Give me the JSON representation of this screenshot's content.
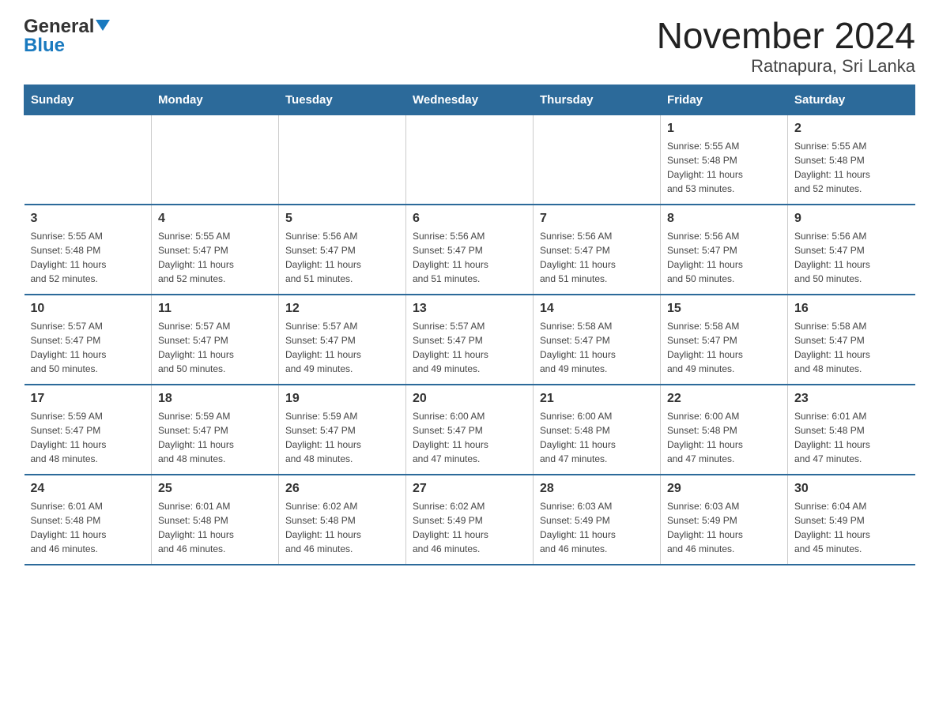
{
  "logo": {
    "general": "General",
    "blue": "Blue"
  },
  "title": "November 2024",
  "subtitle": "Ratnapura, Sri Lanka",
  "weekdays": [
    "Sunday",
    "Monday",
    "Tuesday",
    "Wednesday",
    "Thursday",
    "Friday",
    "Saturday"
  ],
  "weeks": [
    [
      {
        "day": "",
        "info": ""
      },
      {
        "day": "",
        "info": ""
      },
      {
        "day": "",
        "info": ""
      },
      {
        "day": "",
        "info": ""
      },
      {
        "day": "",
        "info": ""
      },
      {
        "day": "1",
        "info": "Sunrise: 5:55 AM\nSunset: 5:48 PM\nDaylight: 11 hours\nand 53 minutes."
      },
      {
        "day": "2",
        "info": "Sunrise: 5:55 AM\nSunset: 5:48 PM\nDaylight: 11 hours\nand 52 minutes."
      }
    ],
    [
      {
        "day": "3",
        "info": "Sunrise: 5:55 AM\nSunset: 5:48 PM\nDaylight: 11 hours\nand 52 minutes."
      },
      {
        "day": "4",
        "info": "Sunrise: 5:55 AM\nSunset: 5:47 PM\nDaylight: 11 hours\nand 52 minutes."
      },
      {
        "day": "5",
        "info": "Sunrise: 5:56 AM\nSunset: 5:47 PM\nDaylight: 11 hours\nand 51 minutes."
      },
      {
        "day": "6",
        "info": "Sunrise: 5:56 AM\nSunset: 5:47 PM\nDaylight: 11 hours\nand 51 minutes."
      },
      {
        "day": "7",
        "info": "Sunrise: 5:56 AM\nSunset: 5:47 PM\nDaylight: 11 hours\nand 51 minutes."
      },
      {
        "day": "8",
        "info": "Sunrise: 5:56 AM\nSunset: 5:47 PM\nDaylight: 11 hours\nand 50 minutes."
      },
      {
        "day": "9",
        "info": "Sunrise: 5:56 AM\nSunset: 5:47 PM\nDaylight: 11 hours\nand 50 minutes."
      }
    ],
    [
      {
        "day": "10",
        "info": "Sunrise: 5:57 AM\nSunset: 5:47 PM\nDaylight: 11 hours\nand 50 minutes."
      },
      {
        "day": "11",
        "info": "Sunrise: 5:57 AM\nSunset: 5:47 PM\nDaylight: 11 hours\nand 50 minutes."
      },
      {
        "day": "12",
        "info": "Sunrise: 5:57 AM\nSunset: 5:47 PM\nDaylight: 11 hours\nand 49 minutes."
      },
      {
        "day": "13",
        "info": "Sunrise: 5:57 AM\nSunset: 5:47 PM\nDaylight: 11 hours\nand 49 minutes."
      },
      {
        "day": "14",
        "info": "Sunrise: 5:58 AM\nSunset: 5:47 PM\nDaylight: 11 hours\nand 49 minutes."
      },
      {
        "day": "15",
        "info": "Sunrise: 5:58 AM\nSunset: 5:47 PM\nDaylight: 11 hours\nand 49 minutes."
      },
      {
        "day": "16",
        "info": "Sunrise: 5:58 AM\nSunset: 5:47 PM\nDaylight: 11 hours\nand 48 minutes."
      }
    ],
    [
      {
        "day": "17",
        "info": "Sunrise: 5:59 AM\nSunset: 5:47 PM\nDaylight: 11 hours\nand 48 minutes."
      },
      {
        "day": "18",
        "info": "Sunrise: 5:59 AM\nSunset: 5:47 PM\nDaylight: 11 hours\nand 48 minutes."
      },
      {
        "day": "19",
        "info": "Sunrise: 5:59 AM\nSunset: 5:47 PM\nDaylight: 11 hours\nand 48 minutes."
      },
      {
        "day": "20",
        "info": "Sunrise: 6:00 AM\nSunset: 5:47 PM\nDaylight: 11 hours\nand 47 minutes."
      },
      {
        "day": "21",
        "info": "Sunrise: 6:00 AM\nSunset: 5:48 PM\nDaylight: 11 hours\nand 47 minutes."
      },
      {
        "day": "22",
        "info": "Sunrise: 6:00 AM\nSunset: 5:48 PM\nDaylight: 11 hours\nand 47 minutes."
      },
      {
        "day": "23",
        "info": "Sunrise: 6:01 AM\nSunset: 5:48 PM\nDaylight: 11 hours\nand 47 minutes."
      }
    ],
    [
      {
        "day": "24",
        "info": "Sunrise: 6:01 AM\nSunset: 5:48 PM\nDaylight: 11 hours\nand 46 minutes."
      },
      {
        "day": "25",
        "info": "Sunrise: 6:01 AM\nSunset: 5:48 PM\nDaylight: 11 hours\nand 46 minutes."
      },
      {
        "day": "26",
        "info": "Sunrise: 6:02 AM\nSunset: 5:48 PM\nDaylight: 11 hours\nand 46 minutes."
      },
      {
        "day": "27",
        "info": "Sunrise: 6:02 AM\nSunset: 5:49 PM\nDaylight: 11 hours\nand 46 minutes."
      },
      {
        "day": "28",
        "info": "Sunrise: 6:03 AM\nSunset: 5:49 PM\nDaylight: 11 hours\nand 46 minutes."
      },
      {
        "day": "29",
        "info": "Sunrise: 6:03 AM\nSunset: 5:49 PM\nDaylight: 11 hours\nand 46 minutes."
      },
      {
        "day": "30",
        "info": "Sunrise: 6:04 AM\nSunset: 5:49 PM\nDaylight: 11 hours\nand 45 minutes."
      }
    ]
  ]
}
